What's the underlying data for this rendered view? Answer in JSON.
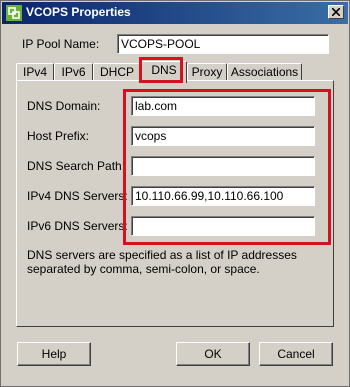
{
  "window": {
    "title": "VCOPS Properties",
    "icon": "vmware-icon"
  },
  "pool": {
    "label": "IP Pool Name:",
    "value": "VCOPS-POOL"
  },
  "tabs": [
    {
      "label": "IPv4",
      "active": false
    },
    {
      "label": "IPv6",
      "active": false
    },
    {
      "label": "DHCP",
      "active": false
    },
    {
      "label": "DNS",
      "active": true
    },
    {
      "label": "Proxy",
      "active": false
    },
    {
      "label": "Associations",
      "active": false
    }
  ],
  "dns": {
    "domain_label": "DNS Domain:",
    "domain_value": "lab.com",
    "host_prefix_label": "Host Prefix:",
    "host_prefix_value": "vcops",
    "search_path_label": "DNS Search Path:",
    "search_path_value": "",
    "ipv4_label": "IPv4 DNS Servers:",
    "ipv4_value": "10.110.66.99,10.110.66.100",
    "ipv6_label": "IPv6 DNS Servers:",
    "ipv6_value": "",
    "note_line1": "DNS servers are specified as a list of IP addresses",
    "note_line2": "separated by comma, semi-colon, or space."
  },
  "buttons": {
    "help": "Help",
    "ok": "OK",
    "cancel": "Cancel"
  },
  "colors": {
    "titlebar_start": "#0a246a",
    "titlebar_end": "#3a6ea5",
    "highlight": "#d4111e",
    "dialog_bg": "#d4d0c8"
  }
}
